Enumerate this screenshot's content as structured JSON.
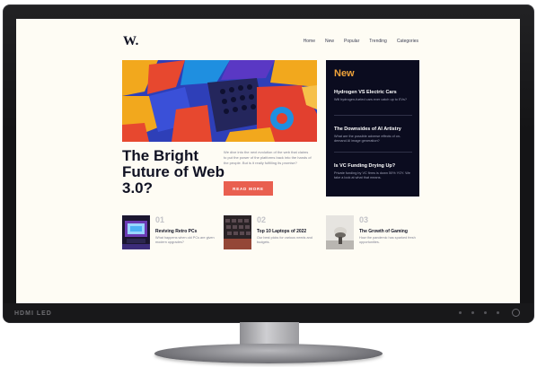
{
  "device": {
    "port_label": "HDMI LED"
  },
  "site": {
    "logo": "W.",
    "nav": [
      "Home",
      "New",
      "Popular",
      "Trending",
      "Categories"
    ]
  },
  "hero": {
    "title": "The Bright Future of Web 3.0?",
    "text": "We dive into the next evolution of the web that claims to put the power of the platforms back into the hands of the people. But is it really fulfilling its promise?",
    "button": "READ MORE"
  },
  "new_section": {
    "heading": "New",
    "items": [
      {
        "title": "Hydrogen VS Electric Cars",
        "desc": "Will hydrogen-fueled cars ever catch up to EVs?"
      },
      {
        "title": "The Downsides of AI Artistry",
        "desc": "What are the possible adverse effects of on-demand AI image generation?"
      },
      {
        "title": "Is VC Funding Drying Up?",
        "desc": "Private funding by VC firms is down 50% YOY. We take a look at what that means."
      }
    ]
  },
  "cards": [
    {
      "num": "01",
      "title": "Reviving Retro PCs",
      "desc": "What happens when old PCs are given modern upgrades?"
    },
    {
      "num": "02",
      "title": "Top 10 Laptops of 2022",
      "desc": "Our best picks for various needs and budgets."
    },
    {
      "num": "03",
      "title": "The Growth of Gaming",
      "desc": "How the pandemic has sparked fresh opportunities."
    }
  ],
  "colors": {
    "accent": "#e95f50",
    "new_heading": "#f0a33a",
    "dark": "#0b0c1f",
    "page_bg": "#fefcf4"
  }
}
